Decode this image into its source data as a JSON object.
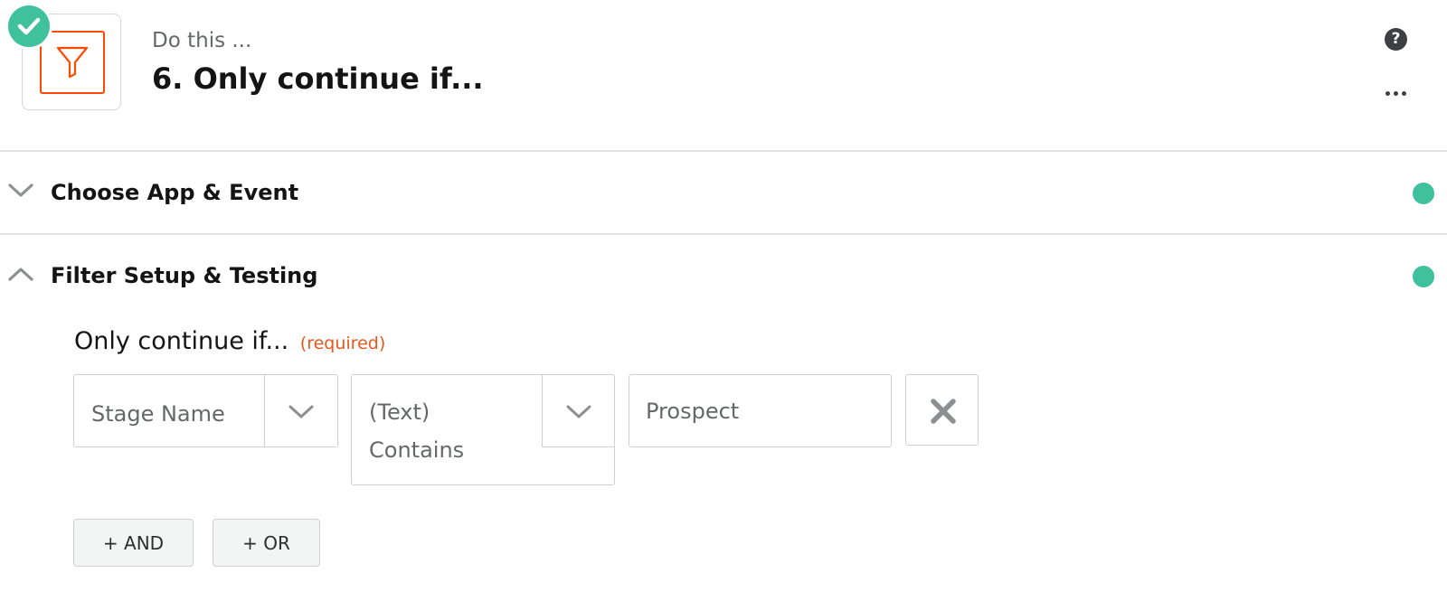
{
  "header": {
    "kicker": "Do this ...",
    "title": "6. Only continue if...",
    "help_label": "?",
    "app_icon": "filter-funnel-icon",
    "status_icon": "check-icon",
    "more_icon": "ellipsis-icon"
  },
  "sections": [
    {
      "title": "Choose App & Event",
      "state": "collapsed",
      "status": "complete"
    },
    {
      "title": "Filter Setup & Testing",
      "state": "expanded",
      "status": "complete"
    }
  ],
  "filter": {
    "label": "Only continue if...",
    "required_text": "(required)",
    "condition": {
      "field": "Stage Name",
      "operator": "(Text) Contains",
      "value": "Prospect"
    },
    "and_label": "+ AND",
    "or_label": "+ OR"
  },
  "colors": {
    "accent_orange": "#ff4a00",
    "success_green": "#3fc19e",
    "required_red": "#e8571b"
  }
}
